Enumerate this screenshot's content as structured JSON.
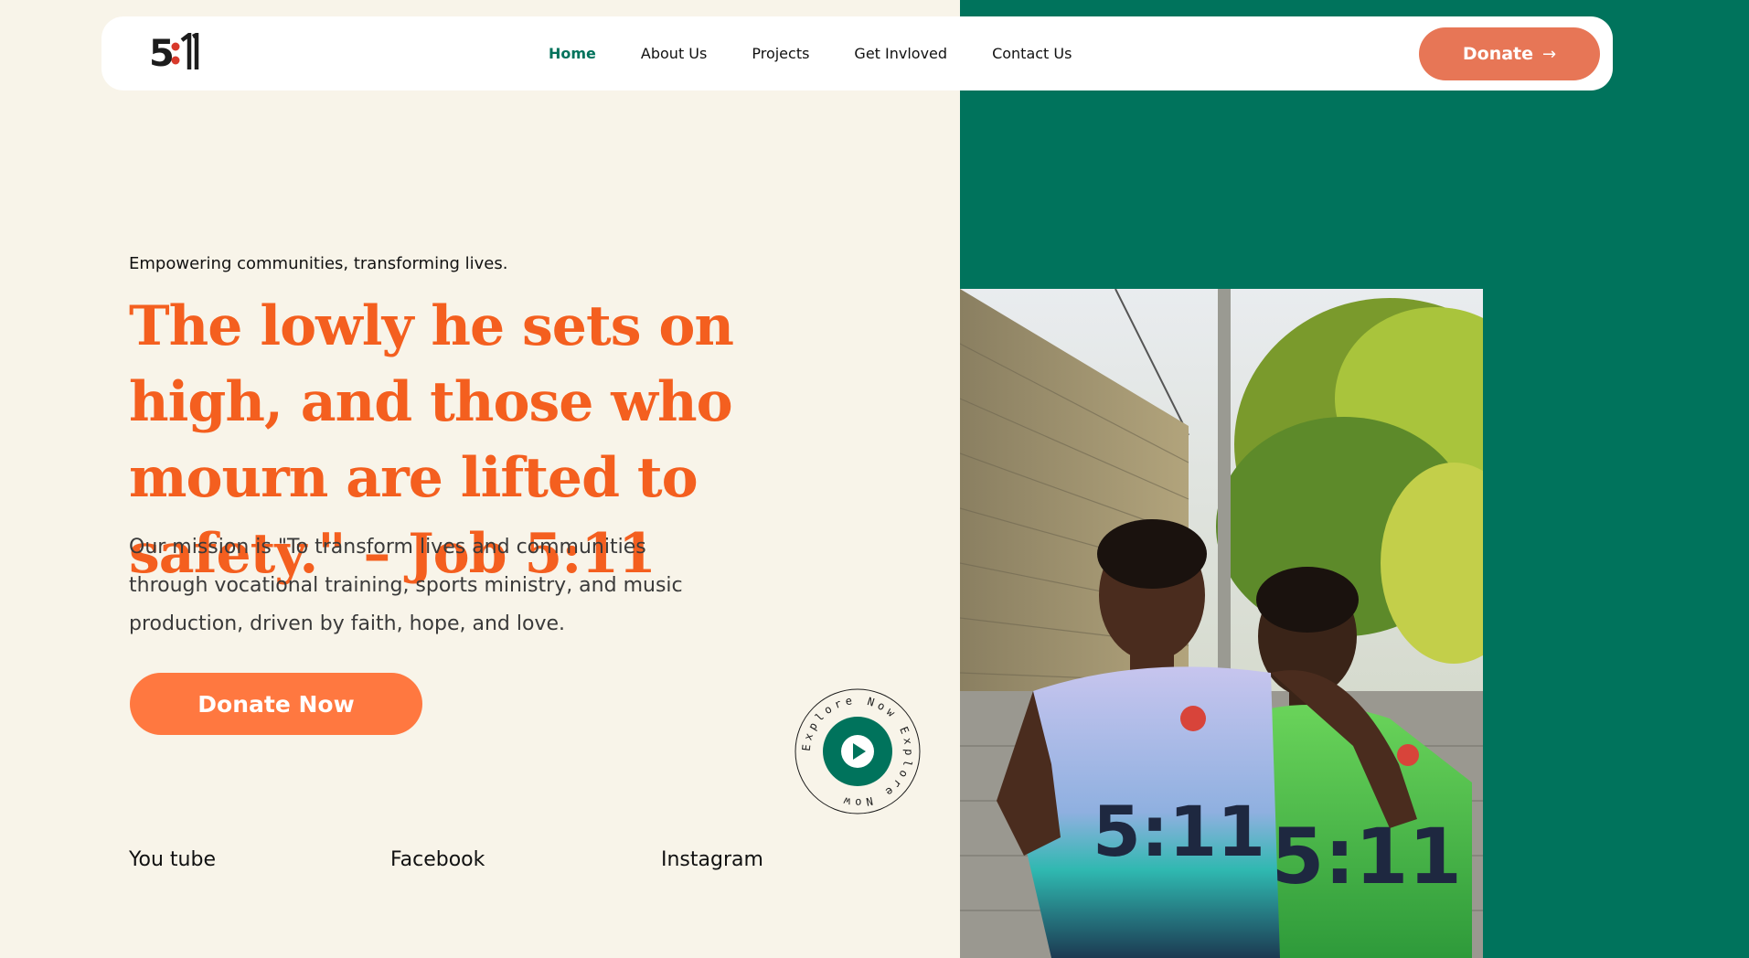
{
  "brand": {
    "logo_text": "5:11",
    "primary_color": "#00735c",
    "accent_color": "#f45f1f",
    "button_color": "#ff7840"
  },
  "nav": {
    "items": [
      {
        "label": "Home",
        "active": true
      },
      {
        "label": "About Us",
        "active": false
      },
      {
        "label": "Projects",
        "active": false
      },
      {
        "label": "Get Invloved",
        "active": false
      },
      {
        "label": "Contact Us",
        "active": false
      }
    ],
    "donate_label": "Donate",
    "donate_icon": "arrow-right-icon"
  },
  "hero": {
    "tagline": "Empowering communities, transforming lives.",
    "headline": "The lowly he sets on high, and those who mourn are lifted to safety.\" – Job 5:11",
    "mission": "Our mission is \"To transform lives and communities through vocational training, sports ministry, and music production, driven by faith, hope, and love.",
    "donate_now_label": "Donate Now"
  },
  "explore_badge": {
    "ring_text": "Explore Now Explore Now ",
    "icon": "play-icon"
  },
  "social": {
    "youtube": "You tube",
    "facebook": "Facebook",
    "instagram": "Instagram"
  },
  "photo": {
    "jersey_text": "5:11"
  }
}
